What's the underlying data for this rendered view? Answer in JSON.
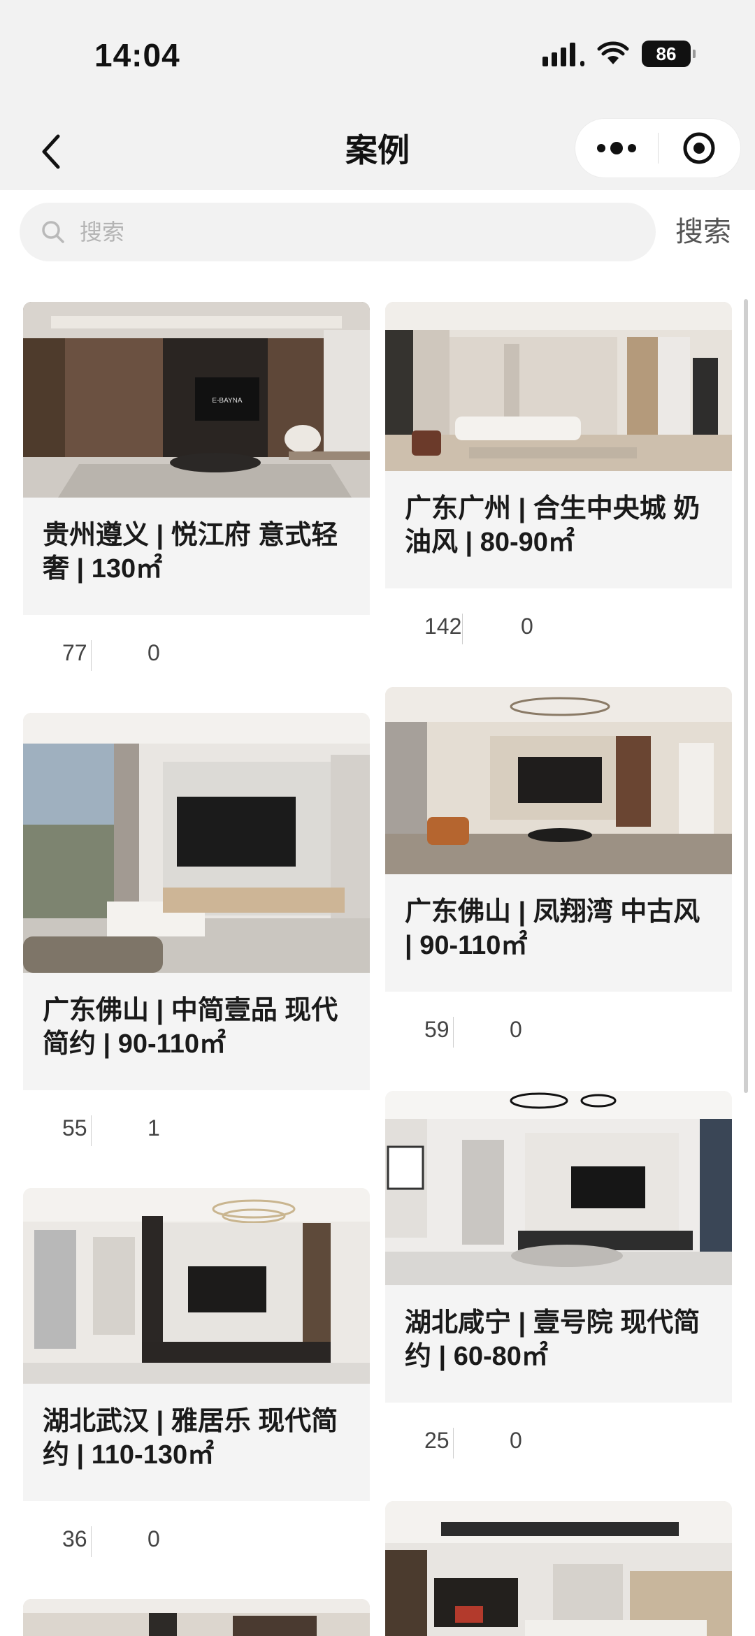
{
  "status_bar": {
    "time": "14:04",
    "battery": "86"
  },
  "nav": {
    "title": "案例"
  },
  "search": {
    "placeholder": "搜索",
    "button_label": "搜索"
  },
  "cases": [
    {
      "title": "贵州遵义 | 悦江府 意式轻奢 | 130㎡",
      "views": "77",
      "comments": "0",
      "tv_label": "E-BAYNA"
    },
    {
      "title": "广东广州 | 合生中央城 奶油风 | 80-90㎡",
      "views": "142",
      "comments": "0"
    },
    {
      "title": "广东佛山 | 中简壹品 现代简约 | 90-110㎡",
      "views": "55",
      "comments": "1"
    },
    {
      "title": "广东佛山 | 凤翔湾 中古风 | 90-110㎡",
      "views": "59",
      "comments": "0"
    },
    {
      "title": "湖北武汉 | 雅居乐 现代简约 | 110-130㎡",
      "views": "36",
      "comments": "0"
    },
    {
      "title": "湖北咸宁 | 壹号院 现代简约 | 60-80㎡",
      "views": "25",
      "comments": "0"
    }
  ]
}
